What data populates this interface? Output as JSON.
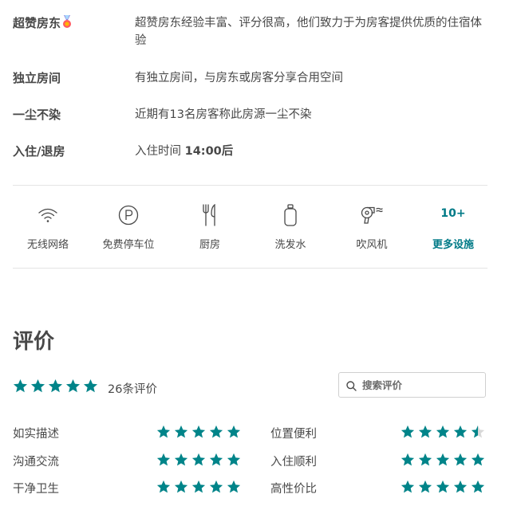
{
  "highlights": [
    {
      "title": "超赞房东",
      "desc": "超赞房东经验丰富、评分很高，他们致力于为房客提供优质的住宿体验",
      "medal": true
    },
    {
      "title": "独立房间",
      "desc": "有独立房间，与房东或房客分享合用空间"
    },
    {
      "title": "一尘不染",
      "desc": "近期有13名房客称此房源一尘不染"
    },
    {
      "title": "入住/退房",
      "desc_prefix": "入住时间 ",
      "desc_bold": "14:00后"
    }
  ],
  "amenities": [
    {
      "label": "无线网络",
      "icon": "wifi-icon"
    },
    {
      "label": "免费停车位",
      "icon": "parking-icon"
    },
    {
      "label": "厨房",
      "icon": "kitchen-utensils-icon"
    },
    {
      "label": "洗发水",
      "icon": "shampoo-bottle-icon"
    },
    {
      "label": "吹风机",
      "icon": "hair-dryer-icon"
    }
  ],
  "more_amenities": {
    "count": "10+",
    "label": "更多设施"
  },
  "reviews": {
    "title": "评价",
    "overall_rating": 5,
    "count_label": "26条评价",
    "search_placeholder": "搜索评价",
    "categories": [
      {
        "label": "如实描述",
        "rating": 5
      },
      {
        "label": "位置便利",
        "rating": 4.5
      },
      {
        "label": "沟通交流",
        "rating": 5
      },
      {
        "label": "入住顺利",
        "rating": 5
      },
      {
        "label": "干净卫生",
        "rating": 5
      },
      {
        "label": "高性价比",
        "rating": 5
      }
    ]
  },
  "colors": {
    "star": "#008489",
    "star_empty": "#d8d8d8",
    "accent": "#007a87",
    "text": "#484848"
  }
}
